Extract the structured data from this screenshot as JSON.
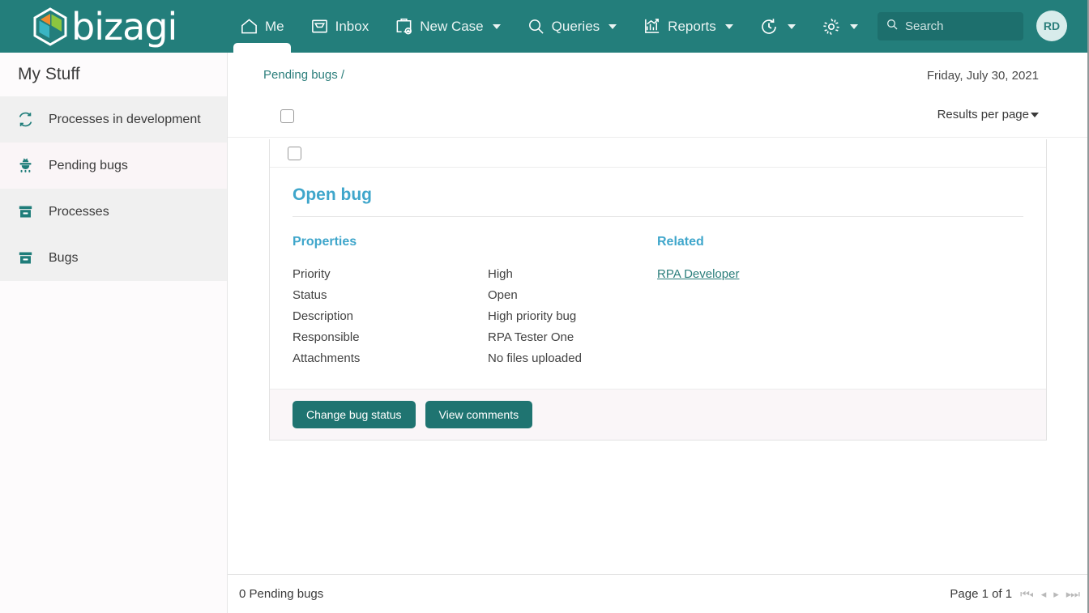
{
  "brand": {
    "name": "bizagi",
    "primary_color": "#237e7b",
    "accent_color": "#3fa6cb"
  },
  "topnav": {
    "items": [
      {
        "label": "Me",
        "icon": "home-icon",
        "active": true,
        "has_caret": false
      },
      {
        "label": "Inbox",
        "icon": "inbox-tray-icon",
        "active": false,
        "has_caret": false
      },
      {
        "label": "New Case",
        "icon": "new-case-briefcase-plus-icon",
        "active": false,
        "has_caret": true
      },
      {
        "label": "Queries",
        "icon": "search-magnifier-icon",
        "active": false,
        "has_caret": true
      },
      {
        "label": "Reports",
        "icon": "reports-bar-chart-icon",
        "active": false,
        "has_caret": true
      },
      {
        "label": "",
        "icon": "sync-refresh-icon",
        "active": false,
        "has_caret": true
      },
      {
        "label": "",
        "icon": "gear-settings-icon",
        "active": false,
        "has_caret": true
      }
    ],
    "search": {
      "placeholder": "Search",
      "value": "",
      "icon": "search-icon"
    },
    "avatar": {
      "initials": "RD"
    }
  },
  "sidebar": {
    "title": "My Stuff",
    "items": [
      {
        "label": "Processes in development",
        "icon": "sync-icon",
        "selected": false
      },
      {
        "label": "Pending bugs",
        "icon": "bug-icon",
        "selected": true
      },
      {
        "label": "Processes",
        "icon": "archive-box-icon",
        "selected": false
      },
      {
        "label": "Bugs",
        "icon": "archive-box-icon",
        "selected": false
      }
    ]
  },
  "pane": {
    "breadcrumb": "Pending bugs /",
    "date": "Friday, July 30, 2021",
    "results_per_page_label": "Results per page"
  },
  "card": {
    "title": "Open bug",
    "properties_heading": "Properties",
    "properties": [
      {
        "key": "Priority",
        "value": "High"
      },
      {
        "key": "Status",
        "value": "Open"
      },
      {
        "key": "Description",
        "value": "High priority bug"
      },
      {
        "key": "Responsible",
        "value": "RPA Tester One"
      },
      {
        "key": "Attachments",
        "value": "No files uploaded"
      }
    ],
    "related_heading": "Related",
    "related_link": "RPA Developer",
    "buttons": [
      {
        "label": "Change bug status"
      },
      {
        "label": "View comments"
      }
    ]
  },
  "footer": {
    "count_text": "0 Pending bugs",
    "page_text": "Page 1 of 1",
    "pager": [
      {
        "glyph": "⏮◂",
        "name": "first-page-button"
      },
      {
        "glyph": "◂",
        "name": "prev-page-button"
      },
      {
        "glyph": "▸",
        "name": "next-page-button"
      },
      {
        "glyph": "▸⏭",
        "name": "last-page-button"
      }
    ]
  }
}
